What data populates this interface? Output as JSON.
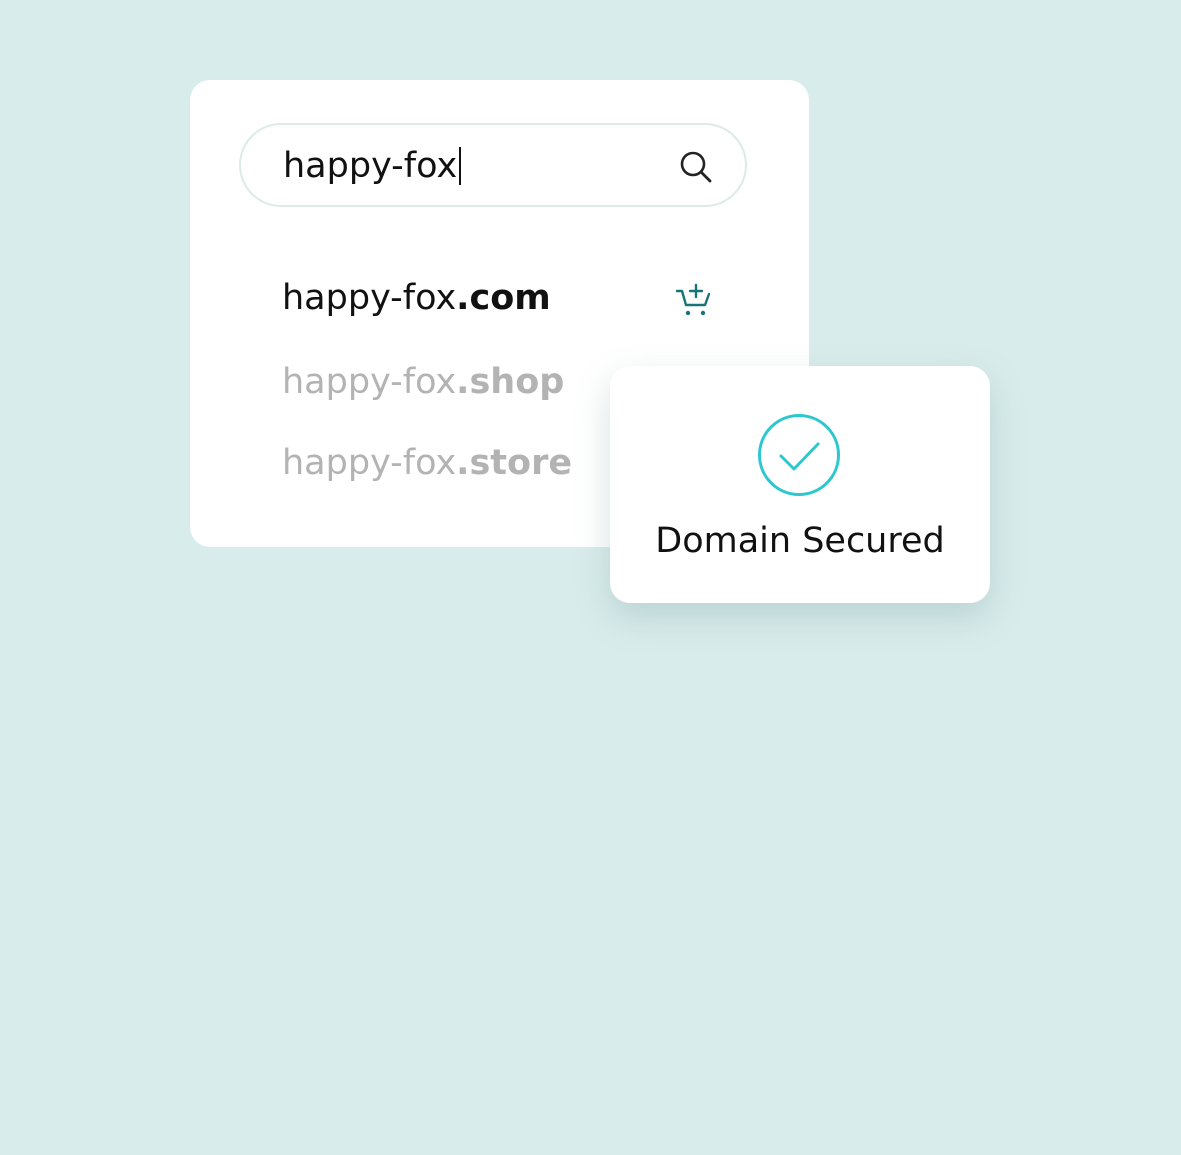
{
  "search": {
    "value": "happy-fox"
  },
  "results": [
    {
      "name": "happy-fox",
      "tld": ".com"
    },
    {
      "name": "happy-fox",
      "tld": ".shop"
    },
    {
      "name": "happy-fox",
      "tld": ".store"
    }
  ],
  "status": {
    "label": "Domain Secured"
  },
  "icons": {
    "search": "search-icon",
    "cart": "cart-add-icon",
    "check": "check-circle-icon"
  },
  "colors": {
    "background": "#d9ecec",
    "accent": "#2dc7cf",
    "cart": "#17757a",
    "primary_text": "#111111",
    "muted_text": "#b3b3b3"
  }
}
